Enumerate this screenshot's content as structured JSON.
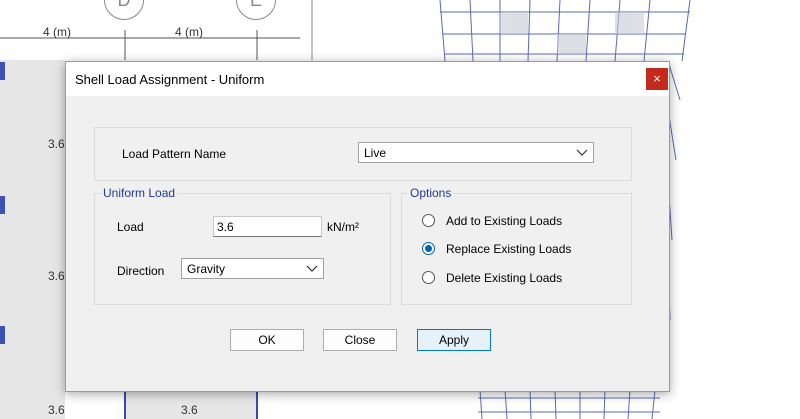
{
  "background": {
    "axis_bubbles": [
      "D",
      "E"
    ],
    "dimension_labels": [
      "4 (m)",
      "4 (m)"
    ],
    "load_labels": [
      "3.6",
      "3.6",
      "3.6",
      "3.6"
    ]
  },
  "dialog": {
    "title": "Shell Load Assignment - Uniform",
    "close_glyph": "×",
    "load_pattern": {
      "label": "Load Pattern Name",
      "value": "Live"
    },
    "uniform_load": {
      "group_label": "Uniform Load",
      "load_label": "Load",
      "load_value": "3.6",
      "unit": "kN/m²",
      "direction_label": "Direction",
      "direction_value": "Gravity"
    },
    "options": {
      "group_label": "Options",
      "items": [
        {
          "label": "Add to Existing Loads",
          "selected": false
        },
        {
          "label": "Replace Existing Loads",
          "selected": true
        },
        {
          "label": "Delete Existing Loads",
          "selected": false
        }
      ]
    },
    "buttons": {
      "ok": "OK",
      "close": "Close",
      "apply": "Apply"
    }
  },
  "colors": {
    "accent": "#0063b1",
    "title_close_bg": "#c42b1c",
    "grid_blue": "#5b6ab5"
  }
}
